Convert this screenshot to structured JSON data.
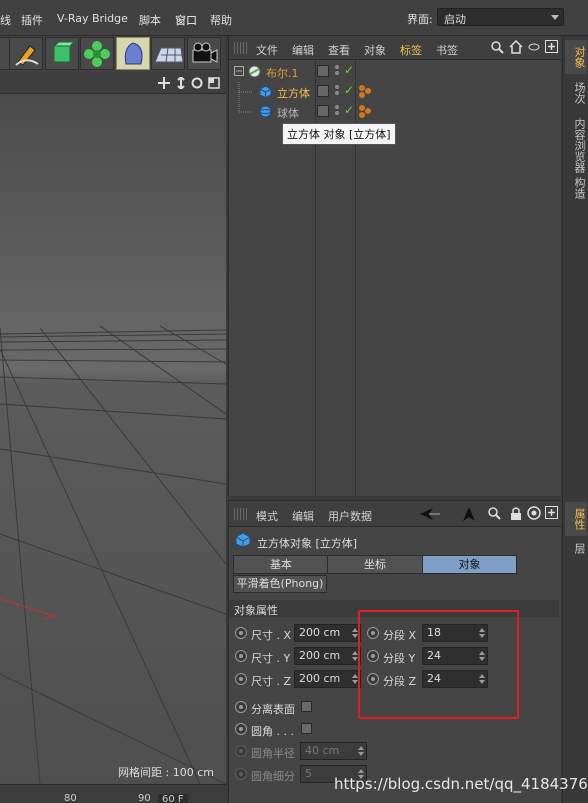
{
  "menubar": {
    "items": [
      "线",
      "插件",
      "V-Ray Bridge",
      "脚本",
      "窗口",
      "帮助"
    ],
    "interface_label": "界面:",
    "interface_value": "启动"
  },
  "toolbar": {
    "icons": [
      "pen-tool-icon",
      "cube-select-icon",
      "cloner-icon",
      "deformer-icon",
      "floor-icon",
      "camera-icon"
    ]
  },
  "viewport": {
    "grid_spacing_label": "网格间距 : 100 cm",
    "timeline_ticks": [
      "80",
      "90"
    ],
    "timeline_field": "60 F"
  },
  "object_manager": {
    "menu": [
      "文件",
      "编辑",
      "查看",
      "对象",
      "标签",
      "书签"
    ],
    "active_menu": "标签",
    "objects": [
      {
        "name": "布尔.1",
        "color": "#e0a030"
      },
      {
        "name": "立方体",
        "color": "#f0c050"
      },
      {
        "name": "球体",
        "color": "#b8b8b8"
      }
    ],
    "tooltip": "立方体 对象 [立方体]"
  },
  "right_tabs_top": [
    "对象",
    "场次",
    "内容浏览器",
    "构造"
  ],
  "right_tabs_bottom": [
    "属性",
    "层"
  ],
  "attribute_manager": {
    "menu": [
      "模式",
      "编辑",
      "用户数据"
    ],
    "title": "立方体对象 [立方体]",
    "tabs": [
      "基本",
      "坐标",
      "对象"
    ],
    "active_tab": "对象",
    "phong_tab": "平滑着色(Phong)",
    "section": "对象属性",
    "sizes": [
      {
        "label": "尺寸 . X",
        "value": "200 cm"
      },
      {
        "label": "尺寸 . Y",
        "value": "200 cm"
      },
      {
        "label": "尺寸 . Z",
        "value": "200 cm"
      }
    ],
    "segments": [
      {
        "label": "分段 X",
        "value": "18"
      },
      {
        "label": "分段 Y",
        "value": "24"
      },
      {
        "label": "分段 Z",
        "value": "24"
      }
    ],
    "separate_surfaces": "分离表面",
    "fillet": "圆角 . . .",
    "fillet_radius_label": "圆角半径",
    "fillet_radius_value": "40 cm",
    "fillet_subdiv_label": "圆角细分",
    "fillet_subdiv_value": "5"
  },
  "watermark": "https://blog.csdn.net/qq_41843762"
}
